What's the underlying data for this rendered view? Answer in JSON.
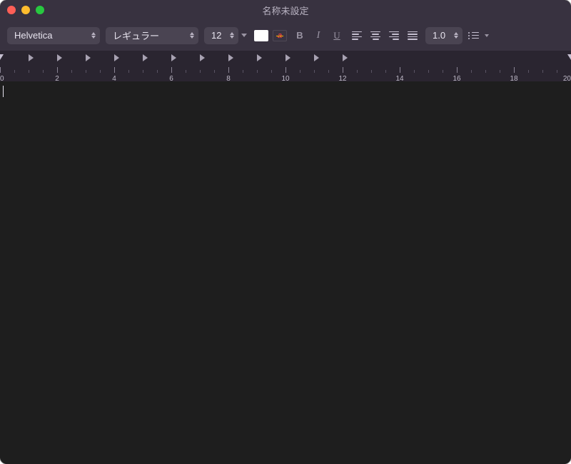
{
  "window": {
    "title": "名称未設定"
  },
  "toolbar": {
    "font_family": "Helvetica",
    "font_style": "レギュラー",
    "font_size": "12",
    "line_spacing": "1.0",
    "bold_label": "B",
    "italic_label": "I",
    "underline_label": "U",
    "highlight_letter": "a",
    "colors": {
      "text": "#ffffff"
    }
  },
  "ruler": {
    "major_labels": [
      "0",
      "2",
      "4",
      "6",
      "8",
      "10",
      "12",
      "14",
      "16",
      "18",
      "20"
    ],
    "tabstops_at_major": [
      0,
      1,
      2,
      3,
      4,
      5,
      6,
      7,
      8,
      9,
      10,
      11
    ]
  },
  "editor": {
    "content": ""
  }
}
